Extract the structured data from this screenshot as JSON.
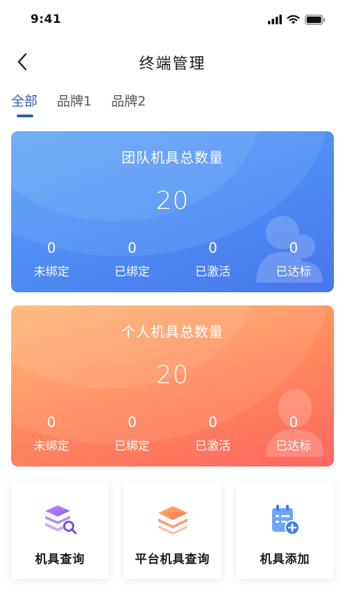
{
  "status_bar": {
    "time": "9:41"
  },
  "nav": {
    "title": "终端管理",
    "back_icon": "chevron-left-icon"
  },
  "tabs": [
    {
      "label": "全部",
      "active": true
    },
    {
      "label": "品牌1",
      "active": false
    },
    {
      "label": "品牌2",
      "active": false
    }
  ],
  "team_card": {
    "title": "团队机具总数量",
    "total": "20",
    "stats": [
      {
        "value": "0",
        "label": "未绑定"
      },
      {
        "value": "0",
        "label": "已绑定"
      },
      {
        "value": "0",
        "label": "已激活"
      },
      {
        "value": "0",
        "label": "已达标"
      }
    ],
    "colors": {
      "start": "#5aa2f7",
      "end": "#4a76ec"
    }
  },
  "personal_card": {
    "title": "个人机具总数量",
    "total": "20",
    "stats": [
      {
        "value": "0",
        "label": "未绑定"
      },
      {
        "value": "0",
        "label": "已绑定"
      },
      {
        "value": "0",
        "label": "已激活"
      },
      {
        "value": "0",
        "label": "已达标"
      }
    ],
    "colors": {
      "start": "#ffb26a",
      "end": "#ff6762"
    }
  },
  "actions": [
    {
      "label": "机具查询",
      "icon": "layers-search-icon"
    },
    {
      "label": "平台机具查询",
      "icon": "layers-icon"
    },
    {
      "label": "机具添加",
      "icon": "calendar-add-icon"
    }
  ],
  "accent_color": "#2d5fa8"
}
